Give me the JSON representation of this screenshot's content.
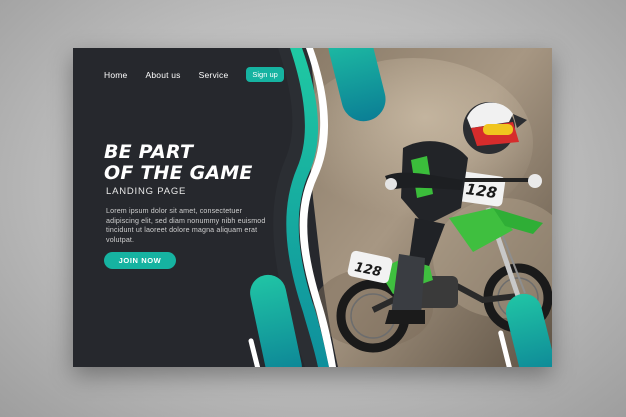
{
  "nav": {
    "links": [
      "Home",
      "About us",
      "Service"
    ],
    "signup_label": "Sign up"
  },
  "hero": {
    "headline_line1": "BE PART",
    "headline_line2": "OF THE GAME",
    "subheading": "LANDING PAGE",
    "body": "Lorem ipsum dolor sit amet, consectetuer adipiscing elit, sed diam nonummy nibh euismod tincidunt ut laoreet dolore magna aliquam erat volutpat.",
    "cta_label": "JOIN NOW"
  },
  "photo": {
    "front_plate_number": "128",
    "side_plate_number": "128"
  },
  "colors": {
    "accent": "#16b3a1",
    "panel": "#26282d",
    "page_background": "#bcbcbc"
  }
}
